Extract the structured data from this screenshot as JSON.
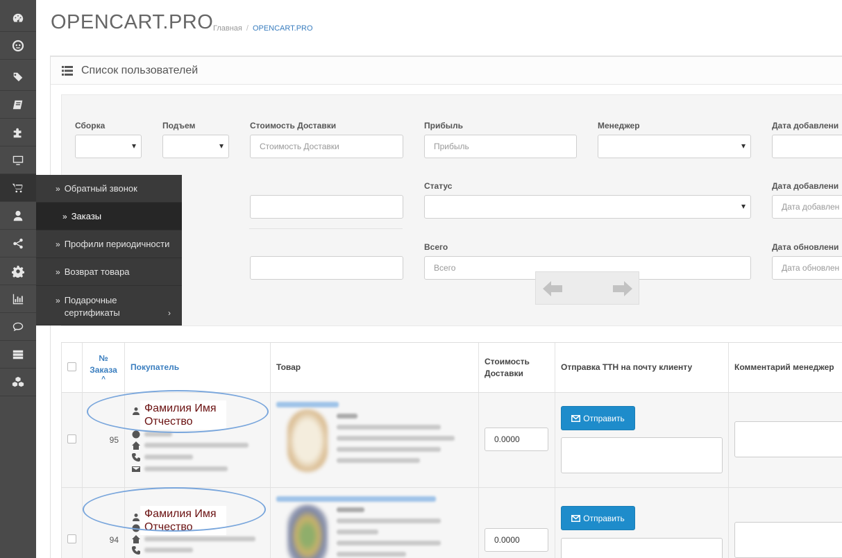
{
  "header": {
    "brand": "OPENCART.PRO",
    "breadcrumb": [
      "Главная",
      "OPENCART.PRO"
    ],
    "breadcrumb_separator": "/"
  },
  "sidebar": {
    "icons": [
      "dashboard-icon",
      "opencart-logo-icon",
      "tags-icon",
      "book-icon",
      "puzzle-icon",
      "monitor-icon",
      "cart-icon",
      "user-icon",
      "share-icon",
      "gear-icon",
      "bar-chart-icon",
      "comment-icon",
      "server-icon",
      "cubes-icon"
    ],
    "active_index": 6
  },
  "submenu": {
    "items": [
      {
        "label": "Обратный звонок",
        "active": false
      },
      {
        "label": "Заказы",
        "active": true
      },
      {
        "label": "Профили периодичности",
        "active": false
      },
      {
        "label": "Возврат товара",
        "active": false
      },
      {
        "label": "Подарочные сертификаты",
        "active": false
      }
    ]
  },
  "panel": {
    "title": "Список пользователей"
  },
  "filters": {
    "assembly_label": "Сборка",
    "lift_label": "Подъем",
    "delivery_cost_label": "Стоимость Доставки",
    "delivery_cost_placeholder": "Стоимость Доставки",
    "profit_label": "Прибыль",
    "profit_placeholder": "Прибыль",
    "manager_label": "Менеджер",
    "date_added_label": "Дата добавлени",
    "status_label": "Статус",
    "date_added_label_2": "Дата добавлени",
    "date_added_placeholder": "Дата добавлен",
    "total_label": "Всего",
    "total_placeholder": "Всего",
    "date_updated_label": "Дата обновлени",
    "date_updated_placeholder": "Дата обновлен"
  },
  "table": {
    "headers": {
      "order_no_line1": "№",
      "order_no_line2": "Заказа",
      "sort_indicator": "^",
      "customer": "Покупатель",
      "product": "Товар",
      "delivery_cost_line1": "Стоимость",
      "delivery_cost_line2": "Доставки",
      "send_ttn": "Отправка ТТН на почту клиенту",
      "manager_comment": "Комментарий менеджер"
    },
    "rows": [
      {
        "order_id": "95",
        "customer_name_line1": "Фамилия Имя",
        "customer_name_line2": "Отчество",
        "delivery_cost": "0.0000",
        "send_label": "Отправить"
      },
      {
        "order_id": "94",
        "customer_name_line1": "Фамилия Имя",
        "customer_name_line2": "Отчество",
        "delivery_cost": "0.0000",
        "send_label": "Отправить"
      }
    ]
  },
  "colors": {
    "sidebar_bg": "#4a4a4a",
    "flyout_bg": "#3a3a3a",
    "primary_button": "#1e8ccb",
    "link": "#3a7ebf",
    "annotation_ellipse": "#79a6dc",
    "annotation_text": "#6a1010"
  }
}
